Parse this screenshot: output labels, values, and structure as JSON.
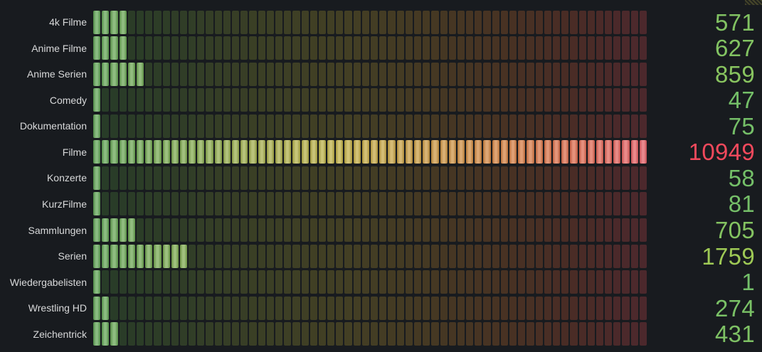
{
  "panel": {
    "background": "#181b1f",
    "label_color": "#d8d9da"
  },
  "chart_data": {
    "type": "bar",
    "subtype": "lcd-bar-gauge",
    "orientation": "horizontal",
    "title": "",
    "xlabel": "",
    "ylabel": "",
    "grid": false,
    "legend_position": "none",
    "categories": [
      "4k Filme",
      "Anime Filme",
      "Anime Serien",
      "Comedy",
      "Dokumentation",
      "Filme",
      "Konzerte",
      "KurzFilme",
      "Sammlungen",
      "Serien",
      "Wiedergabelisten",
      "Wrestling HD",
      "Zeichentrick"
    ],
    "values": [
      571,
      627,
      859,
      47,
      75,
      10949,
      58,
      81,
      705,
      1759,
      1,
      274,
      431
    ],
    "value_labels": [
      "571",
      "627",
      "859",
      "47",
      "75",
      "10949",
      "58",
      "81",
      "705",
      "1759",
      "1",
      "274",
      "431"
    ],
    "min": 0,
    "max": 10949,
    "cell_count": 64,
    "cell_color_stops": [
      [
        0.0,
        "#5ba150"
      ],
      [
        0.15,
        "#7aa84c"
      ],
      [
        0.3,
        "#a3ac47"
      ],
      [
        0.45,
        "#c0ae41"
      ],
      [
        0.6,
        "#c9973e"
      ],
      [
        0.75,
        "#d37d3e"
      ],
      [
        0.88,
        "#dc6549"
      ],
      [
        1.0,
        "#e35a61"
      ]
    ],
    "value_text_color_stops": [
      [
        0.0,
        "#73bf69"
      ],
      [
        0.5,
        "#fade2a"
      ],
      [
        1.0,
        "#f2495c"
      ]
    ],
    "unlit_blend_background": "#141619",
    "unlit_blend_amount": 0.27
  }
}
